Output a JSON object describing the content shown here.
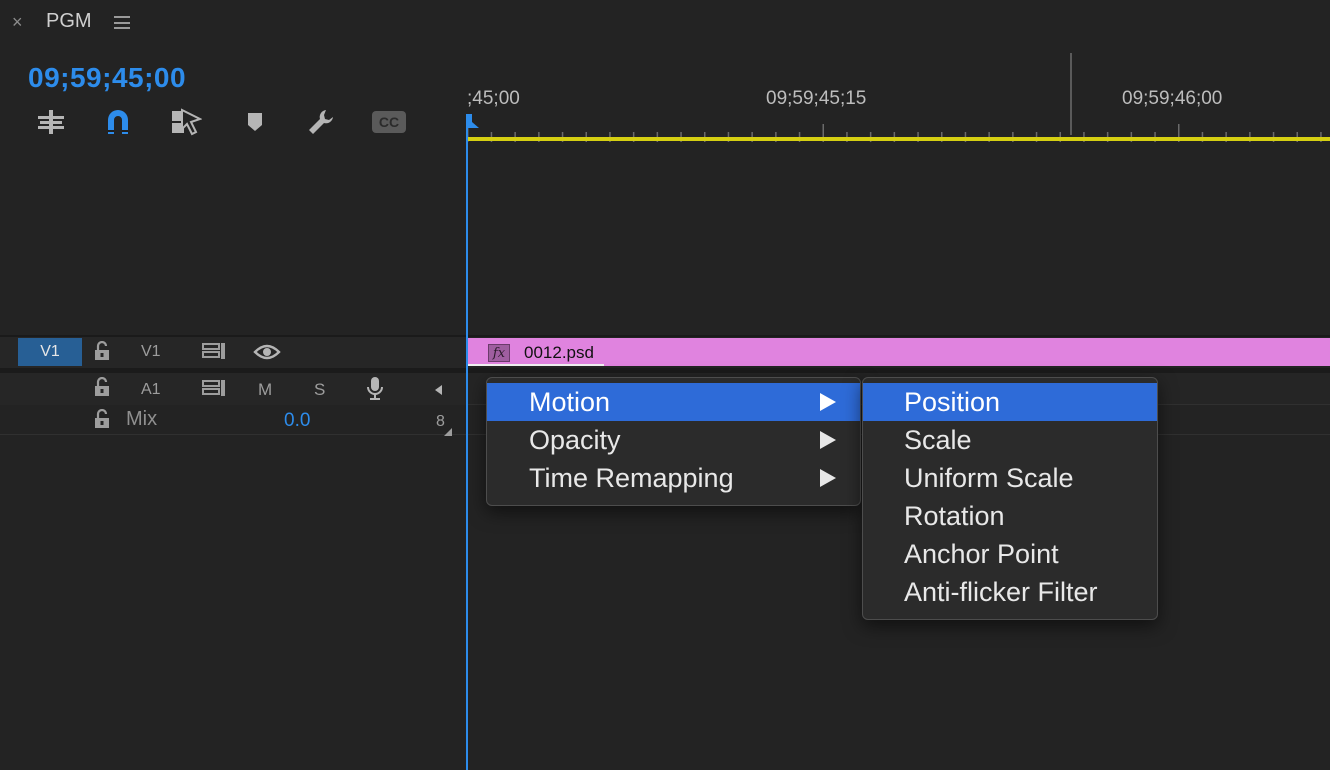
{
  "header": {
    "close_glyph": "×",
    "panel_title": "PGM",
    "menu_icon": "hamburger-icon"
  },
  "timecode": "09;59;45;00",
  "toolbar": {
    "icons": [
      "insert-nest-icon",
      "snap-magnet-icon",
      "linked-selection-icon",
      "add-marker-icon",
      "timeline-settings-wrench-icon",
      "captions-cc-icon"
    ],
    "cc_label": "CC"
  },
  "ruler": {
    "labels": [
      ";45;00",
      "09;59;45;15",
      "09;59;46;00"
    ]
  },
  "tracks": {
    "video": {
      "source_label": "V1",
      "target_label": "V1"
    },
    "audio": {
      "target_label": "A1",
      "mute_label": "M",
      "solo_label": "S"
    },
    "mix": {
      "label": "Mix",
      "value": "0.0",
      "trailing": "8"
    }
  },
  "clip": {
    "fx_label": "fx",
    "name": "0012.psd",
    "color": "#e083df"
  },
  "context_menu": {
    "items": [
      {
        "label": "Motion",
        "selected": true
      },
      {
        "label": "Opacity",
        "selected": false
      },
      {
        "label": "Time Remapping",
        "selected": false
      }
    ]
  },
  "submenu": {
    "items": [
      {
        "label": "Position",
        "selected": true
      },
      {
        "label": "Scale",
        "selected": false
      },
      {
        "label": "Uniform Scale",
        "selected": false
      },
      {
        "label": "Rotation",
        "selected": false
      },
      {
        "label": "Anchor Point",
        "selected": false
      },
      {
        "label": "Anti-flicker Filter",
        "selected": false
      }
    ]
  },
  "colors": {
    "accent_blue": "#2d8ceb",
    "menu_highlight": "#2e6bd8",
    "work_area": "#d5cf12"
  }
}
